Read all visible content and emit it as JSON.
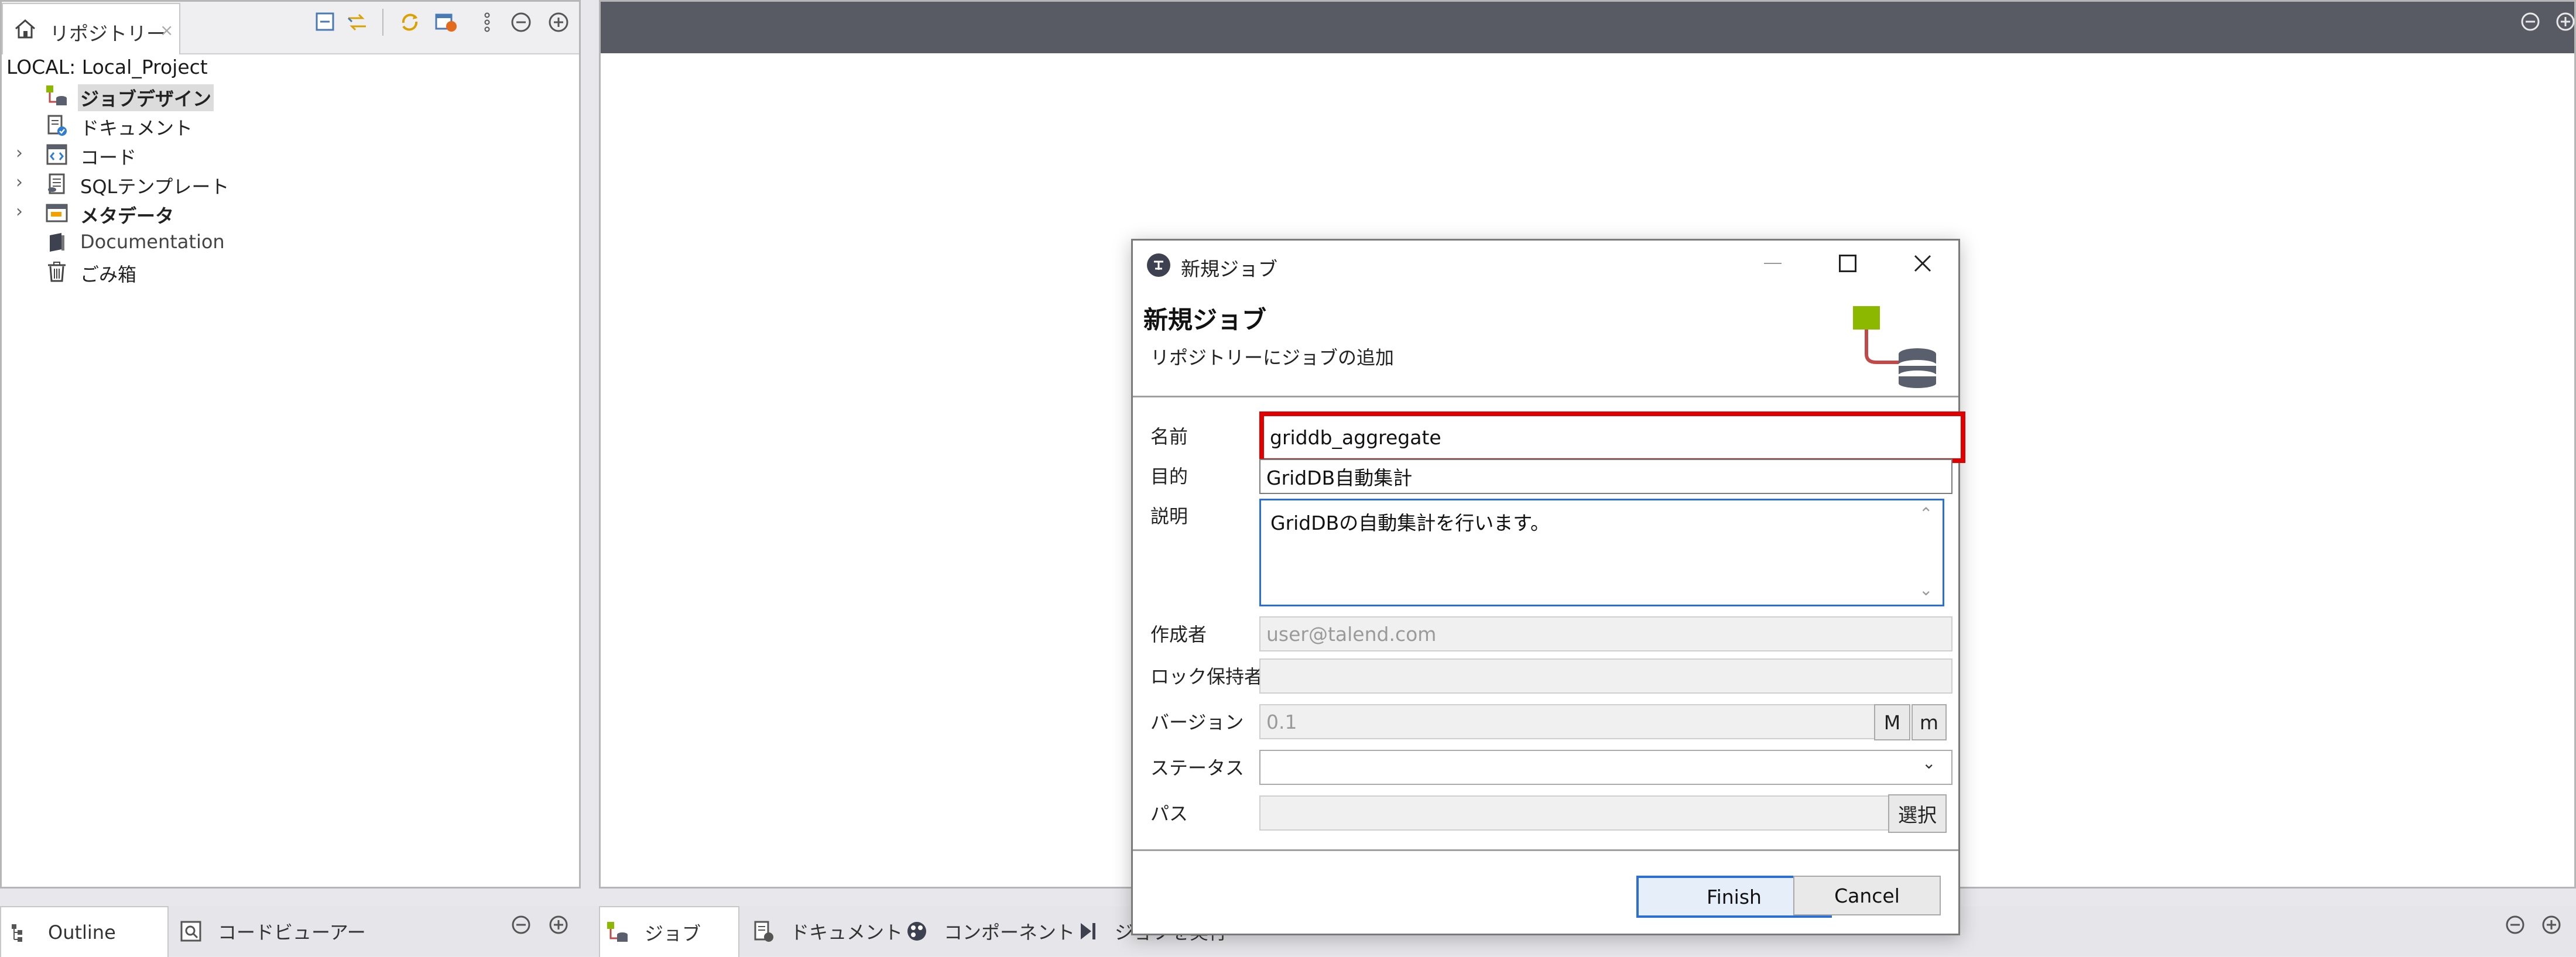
{
  "repository": {
    "tab_label": "リポジトリー",
    "tab_close": "×",
    "project": "LOCAL: Local_Project",
    "tree": [
      {
        "label": "ジョブデザイン",
        "expandable": false,
        "bold": true,
        "selected": true,
        "icon": "job-design-icon"
      },
      {
        "label": "ドキュメント",
        "expandable": false,
        "bold": false,
        "selected": false,
        "icon": "document-icon"
      },
      {
        "label": "コード",
        "expandable": true,
        "bold": false,
        "selected": false,
        "icon": "code-icon"
      },
      {
        "label": "SQLテンプレート",
        "expandable": true,
        "bold": false,
        "selected": false,
        "icon": "sql-template-icon"
      },
      {
        "label": "メタデータ",
        "expandable": true,
        "bold": true,
        "selected": false,
        "icon": "metadata-icon"
      },
      {
        "label": "Documentation",
        "expandable": false,
        "bold": false,
        "selected": false,
        "icon": "documentation-icon"
      },
      {
        "label": "ごみ箱",
        "expandable": false,
        "bold": false,
        "selected": false,
        "icon": "trash-icon"
      }
    ]
  },
  "bottom_tabs": {
    "left": [
      {
        "label": "Outline",
        "icon": "outline-icon",
        "active": true
      },
      {
        "label": "コードビューアー",
        "icon": "code-viewer-icon",
        "active": false
      }
    ],
    "right": [
      {
        "label": "ジョブ",
        "icon": "job-icon",
        "active": true
      },
      {
        "label": "ドキュメント",
        "icon": "document-icon",
        "active": false
      },
      {
        "label": "コンポーネント",
        "icon": "component-icon",
        "active": false
      },
      {
        "label": "ジョブを実行",
        "icon": "run-job-icon",
        "active": false
      }
    ]
  },
  "dialog": {
    "window_title": "新規ジョブ",
    "header_title": "新規ジョブ",
    "header_subtitle": "リポジトリーにジョブの追加",
    "fields": {
      "name": {
        "label": "名前",
        "value": "griddb_aggregate"
      },
      "purpose": {
        "label": "目的",
        "value": "GridDB自動集計"
      },
      "description": {
        "label": "説明",
        "value": "GridDBの自動集計を行います。"
      },
      "author": {
        "label": "作成者",
        "value": "user@talend.com"
      },
      "locker": {
        "label": "ロック保持者",
        "value": ""
      },
      "version": {
        "label": "バージョン",
        "value": "0.1",
        "major_btn": "M",
        "minor_btn": "m"
      },
      "status": {
        "label": "ステータス",
        "value": ""
      },
      "path": {
        "label": "パス",
        "value": "",
        "select_btn": "選択"
      }
    },
    "finish_label": "Finish",
    "cancel_label": "Cancel"
  },
  "colors": {
    "editor_header": "#585a64",
    "highlight_border": "#e00000",
    "default_button_border": "#2a6fd6",
    "job_icon_green": "#8cb800"
  }
}
